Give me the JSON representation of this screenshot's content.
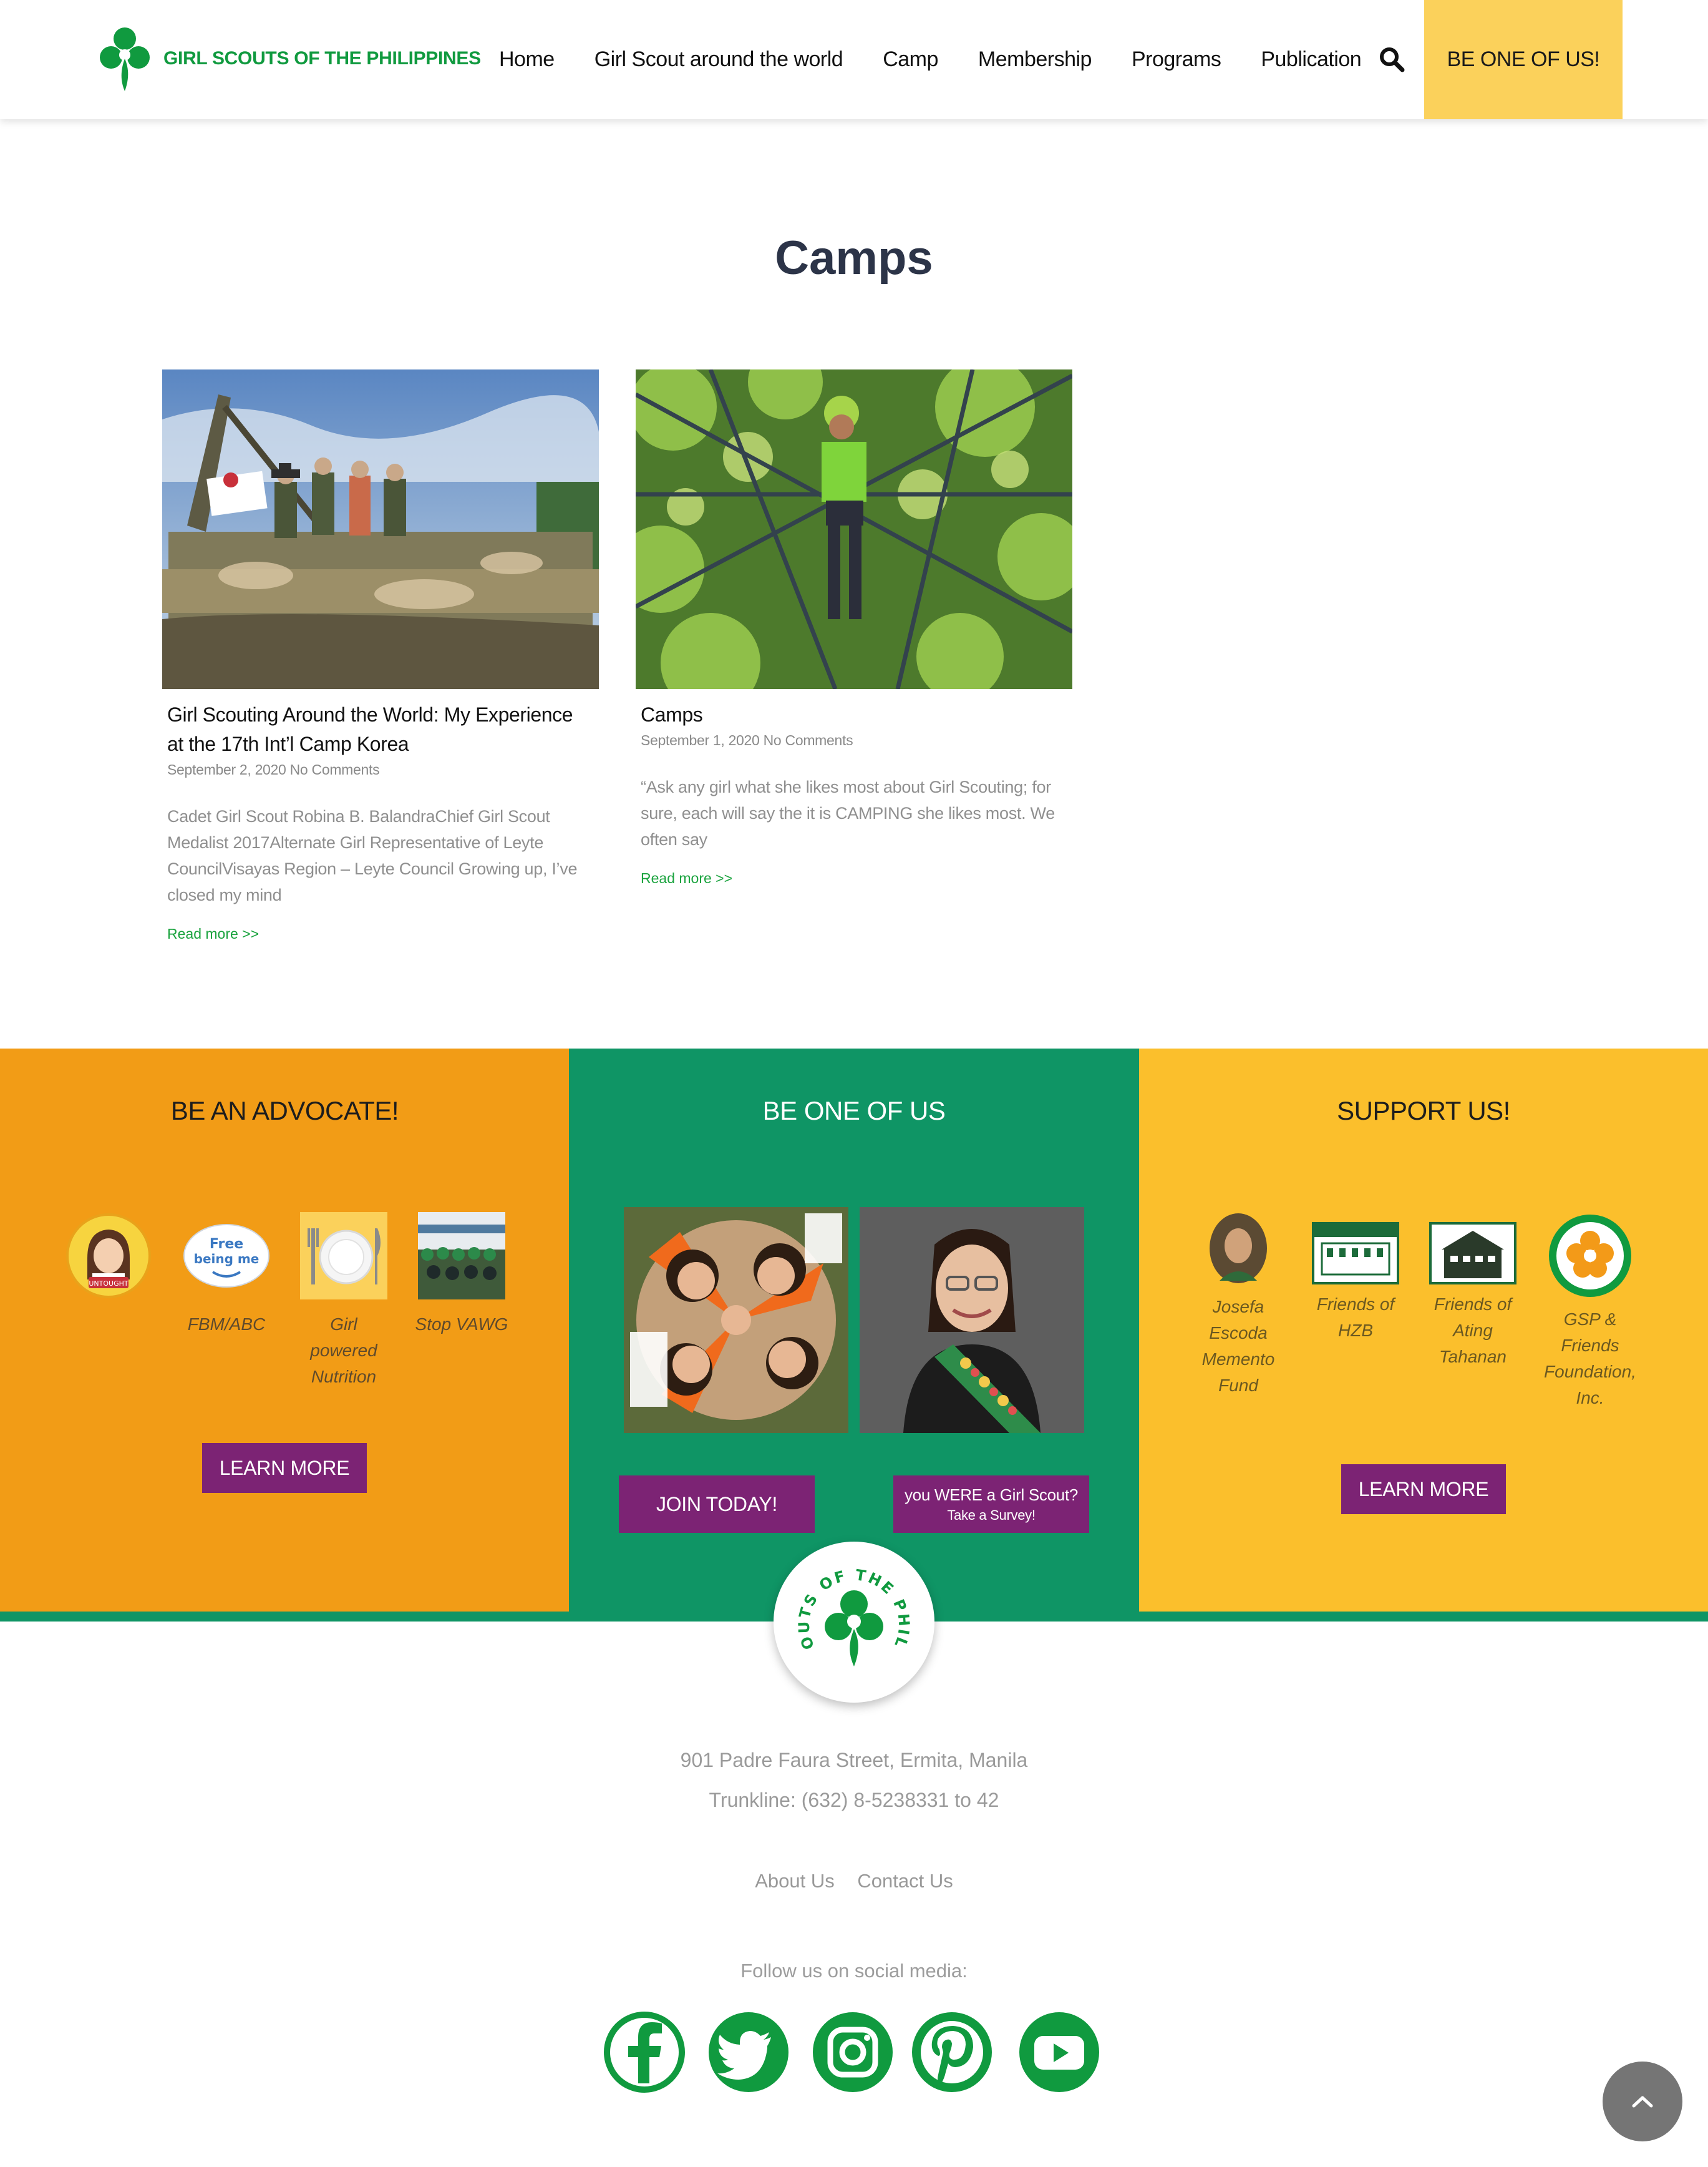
{
  "header": {
    "logo_text": "GIRL SCOUTS OF THE PHILIPPINES",
    "nav": [
      "Home",
      "Girl Scout around the world",
      "Camp",
      "Membership",
      "Programs",
      "Publication"
    ],
    "cta": "BE ONE OF US!"
  },
  "page_title": "Camps",
  "posts": [
    {
      "title": "Girl Scouting Around the World: My Experience at the 17th Int’l Camp Korea",
      "meta": "September 2, 2020 No Comments",
      "excerpt": "Cadet Girl Scout Robina B. BalandraChief Girl Scout Medalist 2017Alternate Girl Representative of Leyte CouncilVisayas Region – Leyte Council Growing up, I’ve closed my mind",
      "read_more": "Read more >>"
    },
    {
      "title": "Camps",
      "meta": "September 1, 2020 No Comments",
      "excerpt": "“Ask any girl what she likes most about Girl Scouting; for sure, each will say the it is CAMPING she likes most. We often say",
      "read_more": "Read more >>"
    }
  ],
  "advocate": {
    "title": "BE AN ADVOCATE!",
    "badge_text": "UNTOUGHT",
    "free_text_1": "Free",
    "free_text_2": "being me",
    "items": [
      "",
      "FBM/ABC",
      "Girl powered Nutrition",
      "Stop VAWG"
    ],
    "button": "LEARN MORE"
  },
  "member": {
    "title": "BE ONE OF US",
    "join_button": "JOIN TODAY!",
    "survey_line1": "you WERE a Girl Scout?",
    "survey_line2": "Take a Survey!"
  },
  "support": {
    "title": "SUPPORT US!",
    "items": [
      "Josefa Escoda Memento Fund",
      "Friends of HZB",
      "Friends of Ating Tahanan",
      "GSP & Friends Foundation, Inc."
    ],
    "button": "LEARN MORE"
  },
  "footer": {
    "badge_text": "GIRL SCOUTS OF THE PHILIPPINES",
    "address": "901 Padre Faura Street, Ermita, Manila",
    "trunkline": "Trunkline: (632) 8-5238331 to 42",
    "links": [
      "About Us",
      "Contact Us"
    ],
    "follow": "Follow us on social media:",
    "social": [
      "facebook-icon",
      "twitter-icon",
      "instagram-icon",
      "pinterest-icon",
      "youtube-icon"
    ]
  },
  "colors": {
    "brand_green": "#109a3f",
    "cta_yellow": "#fbd15b",
    "advocate_orange": "#f29c16",
    "member_green": "#0f9565",
    "support_yellow": "#fbbf2c",
    "button_purple": "#7c2374"
  }
}
